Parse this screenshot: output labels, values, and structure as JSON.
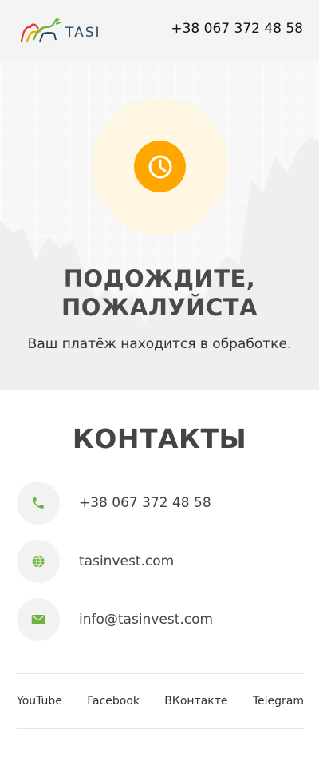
{
  "header": {
    "logo_text": "TASI",
    "phone": "+38 067 372 48 58"
  },
  "hero": {
    "title_line1": "ПОДОЖДИТЕ,",
    "title_line2": "ПОЖАЛУЙСТА",
    "message": "Ваш платёж находится в обработке.",
    "icon": "clock-icon",
    "accent_color": "#ffa600"
  },
  "contacts": {
    "title": "КОНТАКТЫ",
    "items": [
      {
        "icon": "phone-icon",
        "text": "+38 067 372 48 58"
      },
      {
        "icon": "globe-icon",
        "text": "tasinvest.com"
      },
      {
        "icon": "mail-icon",
        "text": "info@tasinvest.com"
      }
    ],
    "icon_color": "#6cb33f"
  },
  "social": {
    "links": [
      "YouTube",
      "Facebook",
      "ВКонтакте",
      "Telegram"
    ]
  }
}
